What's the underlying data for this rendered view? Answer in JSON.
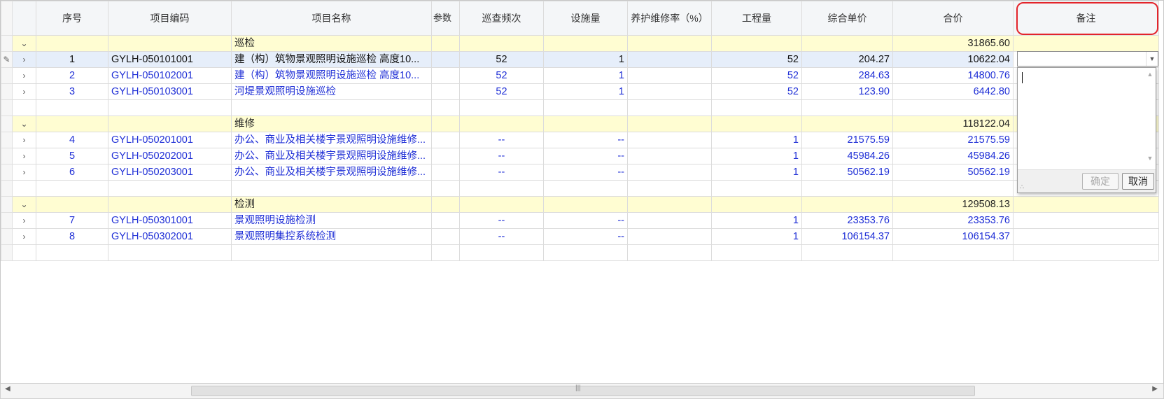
{
  "columns": {
    "seq": "序号",
    "code": "项目编码",
    "name": "项目名称",
    "param": "参数",
    "freq": "巡查频次",
    "facility": "设施量",
    "rate": "养护维修率（%）",
    "qty": "工程量",
    "unit_price": "综合单价",
    "total": "合价",
    "remark": "备注"
  },
  "groups": [
    {
      "name": "巡检",
      "total": "31865.60",
      "rows": [
        {
          "seq": "1",
          "code": "GYLH-050101001",
          "name": "建（构）筑物景观照明设施巡检 高度10...",
          "freq": "52",
          "facility": "1",
          "qty": "52",
          "unit_price": "204.27",
          "total": "10622.04"
        },
        {
          "seq": "2",
          "code": "GYLH-050102001",
          "name": "建（构）筑物景观照明设施巡检 高度10...",
          "freq": "52",
          "facility": "1",
          "qty": "52",
          "unit_price": "284.63",
          "total": "14800.76"
        },
        {
          "seq": "3",
          "code": "GYLH-050103001",
          "name": "河堤景观照明设施巡检",
          "freq": "52",
          "facility": "1",
          "qty": "52",
          "unit_price": "123.90",
          "total": "6442.80"
        }
      ]
    },
    {
      "name": "维修",
      "total": "118122.04",
      "rows": [
        {
          "seq": "4",
          "code": "GYLH-050201001",
          "name": "办公、商业及相关楼宇景观照明设施维修...",
          "freq": "--",
          "facility": "--",
          "qty": "1",
          "unit_price": "21575.59",
          "total": "21575.59"
        },
        {
          "seq": "5",
          "code": "GYLH-050202001",
          "name": "办公、商业及相关楼宇景观照明设施维修...",
          "freq": "--",
          "facility": "--",
          "qty": "1",
          "unit_price": "45984.26",
          "total": "45984.26"
        },
        {
          "seq": "6",
          "code": "GYLH-050203001",
          "name": "办公、商业及相关楼宇景观照明设施维修...",
          "freq": "--",
          "facility": "--",
          "qty": "1",
          "unit_price": "50562.19",
          "total": "50562.19"
        }
      ]
    },
    {
      "name": "检测",
      "total": "129508.13",
      "rows": [
        {
          "seq": "7",
          "code": "GYLH-050301001",
          "name": "景观照明设施检测",
          "freq": "--",
          "facility": "--",
          "qty": "1",
          "unit_price": "23353.76",
          "total": "23353.76"
        },
        {
          "seq": "8",
          "code": "GYLH-050302001",
          "name": "景观照明集控系统检测",
          "freq": "--",
          "facility": "--",
          "qty": "1",
          "unit_price": "106154.37",
          "total": "106154.37"
        }
      ]
    }
  ],
  "popup": {
    "ok": "确定",
    "cancel": "取消",
    "value": ""
  },
  "icons": {
    "expand": "chevron-down-icon",
    "collapse": "chevron-right-icon",
    "edit": "pencil-icon"
  },
  "colors": {
    "group_bg": "#fffdd2",
    "link_text": "#1f2fd6",
    "highlight": "#e3242b",
    "selected_row": "#e6eefa"
  }
}
